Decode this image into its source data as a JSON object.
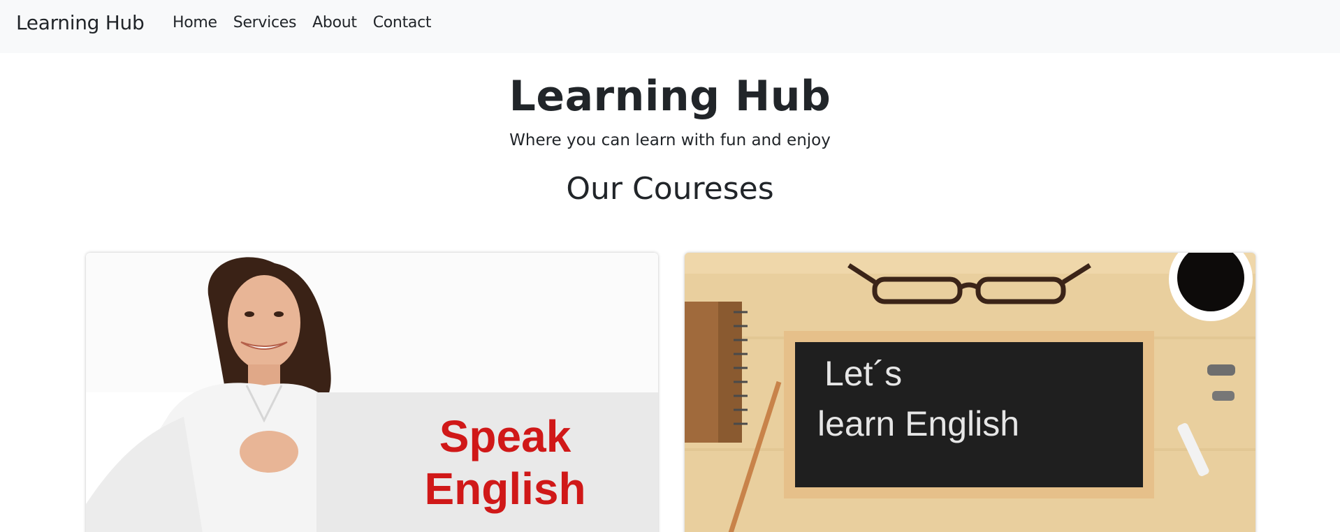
{
  "navbar": {
    "brand": "Learning Hub",
    "links": [
      "Home",
      "Services",
      "About",
      "Contact"
    ]
  },
  "hero": {
    "title": "Learning Hub",
    "subtitle": "Where you can learn with fun and enjoy"
  },
  "courses": {
    "heading": "Our Coureses",
    "cards": [
      {
        "sign_line1": "Speak",
        "sign_line2": "English"
      },
      {
        "board_line1": "Let´s",
        "board_line2": "learn English"
      }
    ]
  }
}
